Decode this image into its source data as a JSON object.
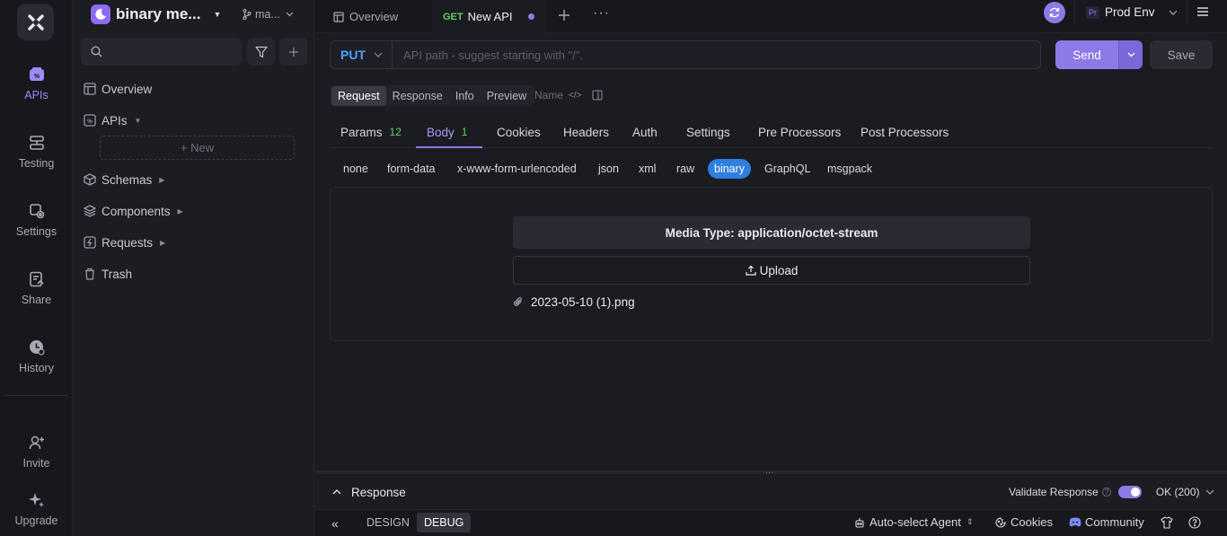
{
  "sidebar_rail": {
    "items": [
      {
        "label": "APIs",
        "icon": "apis-icon"
      },
      {
        "label": "Testing",
        "icon": "testing-icon"
      },
      {
        "label": "Settings",
        "icon": "settings-icon"
      },
      {
        "label": "Share",
        "icon": "share-icon"
      },
      {
        "label": "History",
        "icon": "history-icon"
      },
      {
        "label": "Invite",
        "icon": "invite-icon"
      },
      {
        "label": "Upgrade",
        "icon": "upgrade-icon"
      }
    ]
  },
  "project": {
    "name": "binary me...",
    "branch": "ma..."
  },
  "tree": {
    "overview": "Overview",
    "apis": "APIs",
    "new": "+ New",
    "schemas": "Schemas",
    "components": "Components",
    "requests": "Requests",
    "trash": "Trash"
  },
  "tabs": {
    "overview": "Overview",
    "method": "GET",
    "name": "New API"
  },
  "env": {
    "prefix": "Pr",
    "name": "Prod Env"
  },
  "request": {
    "method": "PUT",
    "url_placeholder": "API path - suggest starting with \"/\".",
    "send": "Send",
    "save": "Save"
  },
  "seg": {
    "request": "Request",
    "response": "Response",
    "info": "Info",
    "preview": "Preview",
    "name": "Name"
  },
  "subtabs": [
    {
      "label": "Params",
      "badge": "12"
    },
    {
      "label": "Body",
      "badge": "1"
    },
    {
      "label": "Cookies"
    },
    {
      "label": "Headers"
    },
    {
      "label": "Auth"
    },
    {
      "label": "Settings"
    },
    {
      "label": "Pre Processors"
    },
    {
      "label": "Post Processors"
    }
  ],
  "body_types": [
    "none",
    "form-data",
    "x-www-form-urlencoded",
    "json",
    "xml",
    "raw",
    "binary",
    "GraphQL",
    "msgpack"
  ],
  "body": {
    "media_type": "Media Type: application/octet-stream",
    "upload": "Upload",
    "file": "2023-05-10 (1).png"
  },
  "response": {
    "title": "Response",
    "validate": "Validate Response",
    "status": "OK (200)"
  },
  "statusbar": {
    "design": "DESIGN",
    "debug": "DEBUG",
    "agent": "Auto-select Agent",
    "cookies": "Cookies",
    "community": "Community"
  },
  "colors": {
    "accent": "#8d7ae6",
    "method_put": "#4da3ff",
    "method_get": "#5fd35f",
    "binary_active": "#2f7ee0"
  }
}
